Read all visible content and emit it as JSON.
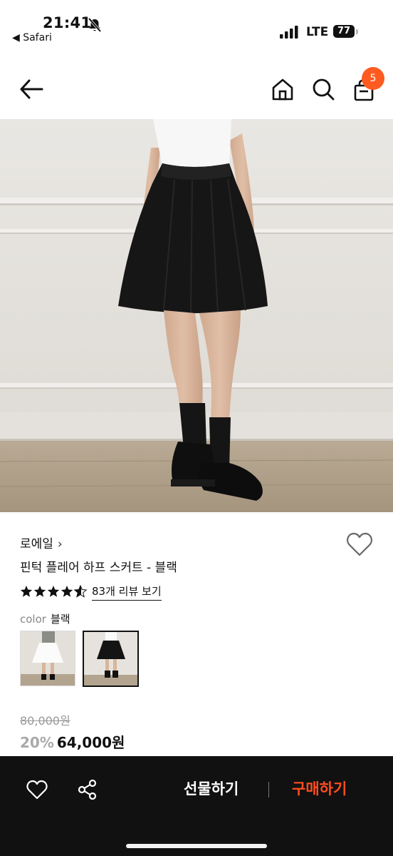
{
  "status_bar": {
    "time": "21:41",
    "back_app": "◀ Safari",
    "carrier": "LTE",
    "battery": "77"
  },
  "nav": {
    "cart_count": "5"
  },
  "product": {
    "brand": "로에일",
    "brand_chevron": "›",
    "title": "핀턱 플레어 하프 스커트 - 블랙",
    "rating": 4.6,
    "review_link": "83개 리뷰 보기",
    "color_label": "color",
    "color_value": "블랙",
    "original_price": "80,000원",
    "discount": "20%",
    "final_price": "64,000원"
  },
  "bottom_bar": {
    "gift_label": "선물하기",
    "buy_label": "구매하기"
  },
  "colors": {
    "accent": "#ff5a1f",
    "buy": "#ff4d1f",
    "bottom_bar": "#111111"
  },
  "icons": [
    "notification-muted-icon",
    "signal-icon",
    "back-arrow-icon",
    "home-icon",
    "search-icon",
    "cart-icon",
    "heart-icon",
    "star-icon",
    "share-icon"
  ]
}
